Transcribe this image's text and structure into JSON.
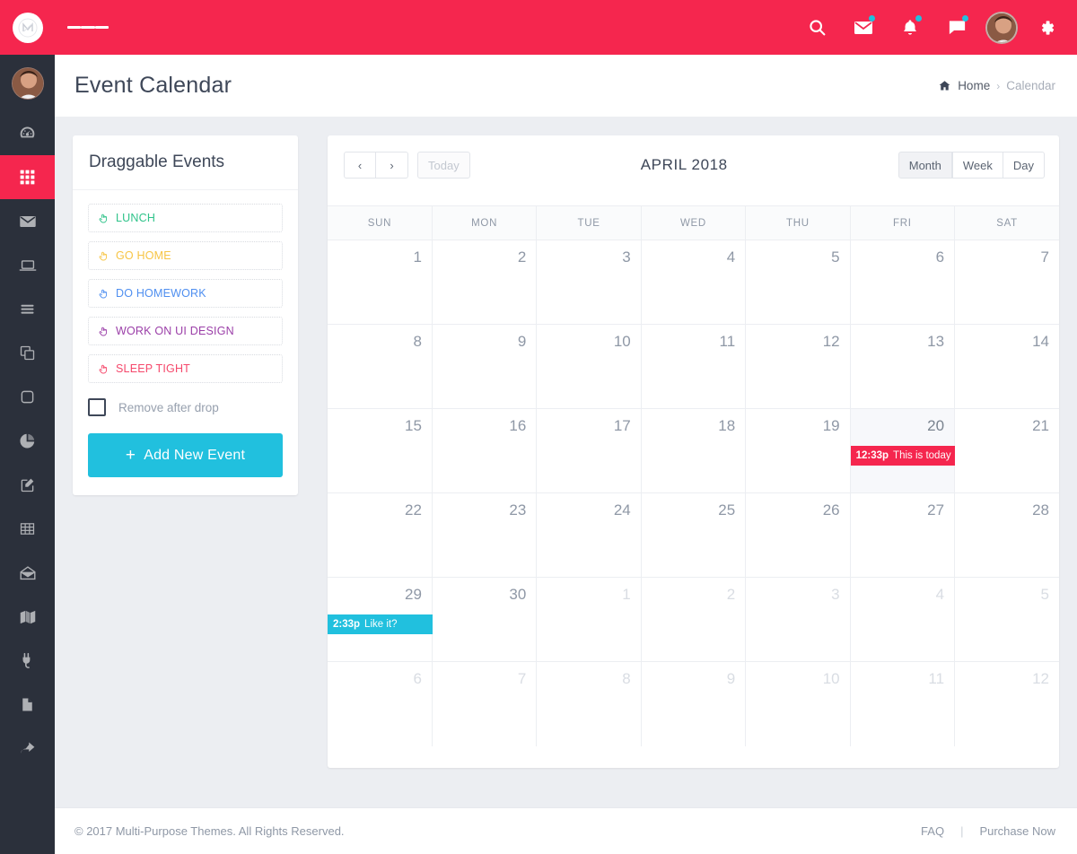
{
  "topbar": {
    "brand_name": "logo-monogram",
    "menu_toggle": "hamburger-icon",
    "icons": [
      {
        "name": "search-icon",
        "badge": false
      },
      {
        "name": "mail-icon",
        "badge": true
      },
      {
        "name": "bell-icon",
        "badge": true
      },
      {
        "name": "chat-icon",
        "badge": true
      }
    ],
    "avatar": "user-avatar",
    "settings": "gear-icon",
    "bg_color": "#f5264e"
  },
  "sidebar": {
    "bg_color": "#2b303b",
    "active_color": "#f5264e",
    "items": [
      {
        "icon": "avatar",
        "active": false
      },
      {
        "icon": "speedometer-icon",
        "active": false
      },
      {
        "icon": "grid-apps-icon",
        "active": true
      },
      {
        "icon": "mail-icon",
        "active": false
      },
      {
        "icon": "laptop-icon",
        "active": false
      },
      {
        "icon": "list-icon",
        "active": false
      },
      {
        "icon": "copy-icon",
        "active": false
      },
      {
        "icon": "square-icon",
        "active": false
      },
      {
        "icon": "pie-chart-icon",
        "active": false
      },
      {
        "icon": "edit-square-icon",
        "active": false
      },
      {
        "icon": "table-icon",
        "active": false
      },
      {
        "icon": "open-envelope-icon",
        "active": false
      },
      {
        "icon": "map-icon",
        "active": false
      },
      {
        "icon": "plug-icon",
        "active": false
      },
      {
        "icon": "file-icon",
        "active": false
      },
      {
        "icon": "arrow-forward-icon",
        "active": false
      }
    ]
  },
  "page": {
    "title": "Event Calendar",
    "breadcrumb": {
      "home_icon": "home-icon",
      "home": "Home",
      "separator": "›",
      "current": "Calendar"
    }
  },
  "draggable_panel": {
    "title": "Draggable Events",
    "events": [
      {
        "label": "LUNCH",
        "color": "#2fc38a"
      },
      {
        "label": "GO HOME",
        "color": "#f7c545"
      },
      {
        "label": "DO HOMEWORK",
        "color": "#4f8ff0"
      },
      {
        "label": "WORK ON UI DESIGN",
        "color": "#9b3fa8"
      },
      {
        "label": "SLEEP TIGHT",
        "color": "#f5486b"
      }
    ],
    "checkbox": {
      "label": "Remove after drop",
      "checked": false
    },
    "add_button": {
      "label": "Add New Event",
      "plus": "+",
      "color": "#21c0de"
    }
  },
  "calendar": {
    "toolbar": {
      "prev": "‹",
      "next": "›",
      "today": "Today",
      "today_disabled": true,
      "title": "APRIL 2018",
      "views": [
        {
          "label": "Month",
          "active": true
        },
        {
          "label": "Week",
          "active": false
        },
        {
          "label": "Day",
          "active": false
        }
      ]
    },
    "weekdays": [
      "SUN",
      "MON",
      "TUE",
      "WED",
      "THU",
      "FRI",
      "SAT"
    ],
    "weeks": [
      [
        {
          "day": "1",
          "other": false
        },
        {
          "day": "2",
          "other": false
        },
        {
          "day": "3",
          "other": false
        },
        {
          "day": "4",
          "other": false
        },
        {
          "day": "5",
          "other": false
        },
        {
          "day": "6",
          "other": false
        },
        {
          "day": "7",
          "other": false
        }
      ],
      [
        {
          "day": "8",
          "other": false
        },
        {
          "day": "9",
          "other": false
        },
        {
          "day": "10",
          "other": false
        },
        {
          "day": "11",
          "other": false
        },
        {
          "day": "12",
          "other": false
        },
        {
          "day": "13",
          "other": false
        },
        {
          "day": "14",
          "other": false
        }
      ],
      [
        {
          "day": "15",
          "other": false
        },
        {
          "day": "16",
          "other": false
        },
        {
          "day": "17",
          "other": false
        },
        {
          "day": "18",
          "other": false
        },
        {
          "day": "19",
          "other": false
        },
        {
          "day": "20",
          "other": false,
          "today": true,
          "event": {
            "time": "12:33p",
            "title": "This is today",
            "color": "red"
          }
        },
        {
          "day": "21",
          "other": false
        }
      ],
      [
        {
          "day": "22",
          "other": false
        },
        {
          "day": "23",
          "other": false
        },
        {
          "day": "24",
          "other": false
        },
        {
          "day": "25",
          "other": false
        },
        {
          "day": "26",
          "other": false
        },
        {
          "day": "27",
          "other": false
        },
        {
          "day": "28",
          "other": false
        }
      ],
      [
        {
          "day": "29",
          "other": false,
          "event": {
            "time": "2:33p",
            "title": "Like it?",
            "color": "cyan"
          }
        },
        {
          "day": "30",
          "other": false
        },
        {
          "day": "1",
          "other": true
        },
        {
          "day": "2",
          "other": true
        },
        {
          "day": "3",
          "other": true
        },
        {
          "day": "4",
          "other": true
        },
        {
          "day": "5",
          "other": true
        }
      ],
      [
        {
          "day": "6",
          "other": true
        },
        {
          "day": "7",
          "other": true
        },
        {
          "day": "8",
          "other": true
        },
        {
          "day": "9",
          "other": true
        },
        {
          "day": "10",
          "other": true
        },
        {
          "day": "11",
          "other": true
        },
        {
          "day": "12",
          "other": true
        }
      ]
    ]
  },
  "footer": {
    "copyright": "© 2017 Multi-Purpose Themes. All Rights Reserved.",
    "links": [
      "FAQ",
      "Purchase Now"
    ],
    "separator": "|"
  }
}
